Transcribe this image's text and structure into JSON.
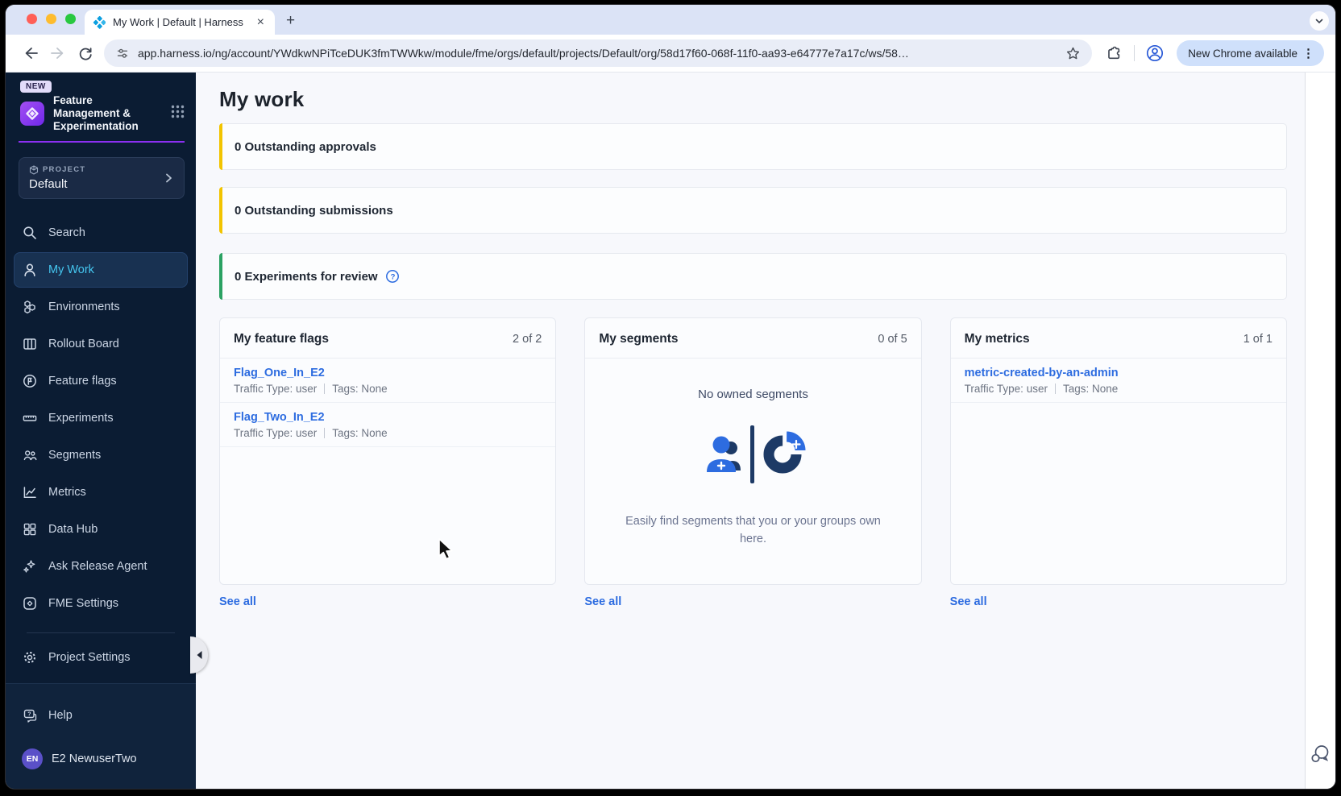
{
  "browser": {
    "tab": {
      "title": "My Work | Default | Harness",
      "close_glyph": "×",
      "new_tab_glyph": "+"
    },
    "toolbar": {
      "url": "app.harness.io/ng/account/YWdkwNPiTceDUK3fmTWWkw/module/fme/orgs/default/projects/Default/org/58d17f60-068f-11f0-aa93-e64777e7a17c/ws/58…",
      "update_chip": "New Chrome available",
      "menu_glyph": "⋮"
    }
  },
  "sidebar": {
    "new_badge": "NEW",
    "app_title": "Feature Management & Experimentation",
    "project": {
      "label": "PROJECT",
      "name": "Default"
    },
    "items": [
      {
        "label": "Search"
      },
      {
        "label": "My Work"
      },
      {
        "label": "Environments"
      },
      {
        "label": "Rollout Board"
      },
      {
        "label": "Feature flags"
      },
      {
        "label": "Experiments"
      },
      {
        "label": "Segments"
      },
      {
        "label": "Metrics"
      },
      {
        "label": "Data Hub"
      },
      {
        "label": "Ask Release Agent"
      },
      {
        "label": "FME Settings"
      }
    ],
    "project_settings": "Project Settings",
    "help": "Help",
    "user": {
      "initials": "EN",
      "name": "E2 NewuserTwo"
    }
  },
  "main": {
    "title": "My work",
    "banners": [
      {
        "label": "0 Outstanding approvals"
      },
      {
        "label": "0 Outstanding submissions"
      },
      {
        "label": "0 Experiments for review"
      }
    ],
    "cards": [
      {
        "title": "My feature flags",
        "count": "2 of 2",
        "see_all": "See all",
        "items": [
          {
            "name": "Flag_One_In_E2",
            "traffic": "Traffic Type: user",
            "tags": "Tags: None"
          },
          {
            "name": "Flag_Two_In_E2",
            "traffic": "Traffic Type: user",
            "tags": "Tags: None"
          }
        ]
      },
      {
        "title": "My segments",
        "count": "0 of 5",
        "see_all": "See all",
        "empty": {
          "heading": "No owned segments",
          "caption": "Easily find segments that you or your groups own here."
        }
      },
      {
        "title": "My metrics",
        "count": "1 of 1",
        "see_all": "See all",
        "items": [
          {
            "name": "metric-created-by-an-admin",
            "traffic": "Traffic Type: user",
            "tags": "Tags: None"
          }
        ]
      }
    ]
  },
  "colors": {
    "accent_purple": "#8B2FF0",
    "link_blue": "#2D6CE0",
    "warning_yellow": "#F2C400",
    "success_green": "#2BA263",
    "active_cyan": "#45C7F0",
    "sidebar_navy": "#0B1C33"
  }
}
